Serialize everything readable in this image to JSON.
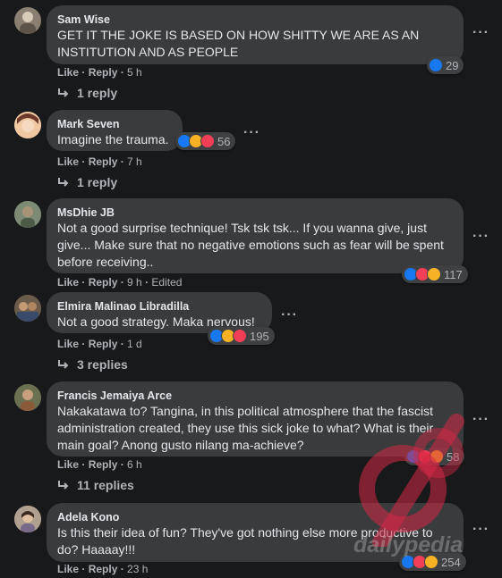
{
  "colors": {
    "background": "#18191a",
    "bubble": "#3a3b3c",
    "muted": "#b0b3b8",
    "like": "#1877f2",
    "love": "#f33e58"
  },
  "actions": {
    "like": "Like",
    "reply": "Reply"
  },
  "comments": [
    {
      "author": "Sam Wise",
      "text": "GET IT THE JOKE IS BASED ON HOW SHITTY WE ARE AS AN INSTITUTION AND AS PEOPLE",
      "time": "5 h",
      "reaction_count": "29",
      "replies": "1 reply"
    },
    {
      "author": "Mark Seven",
      "text": "Imagine the trauma.",
      "time": "7 h",
      "reaction_count": "56",
      "replies": "1 reply"
    },
    {
      "author": "MsDhie JB",
      "text": "Not a good surprise technique! Tsk tsk tsk... If you wanna give, just give... Make sure that no negative emotions such as fear will be spent before receiving..",
      "time": "9 h",
      "edited": "Edited",
      "reaction_count": "117"
    },
    {
      "author": "Elmira Malinao Libradilla",
      "text": "Not a good strategy. Maka nervous!",
      "time": "1 d",
      "reaction_count": "195",
      "replies": "3 replies"
    },
    {
      "author": "Francis Jemaiya Arce",
      "text": "Nakakatawa to? Tangina, in this political atmosphere that the fascist administration created, they use this sick joke to what? What is their main goal? Anong gusto nilang ma-achieve?",
      "time": "6 h",
      "reaction_count": "58",
      "replies": "11 replies"
    },
    {
      "author": "Adela Kono",
      "text": "Is this their idea of fun? They've got nothing else more productive to do? Haaaay!!!",
      "time": "23 h",
      "reaction_count": "254"
    }
  ],
  "watermark": "dailypedia"
}
